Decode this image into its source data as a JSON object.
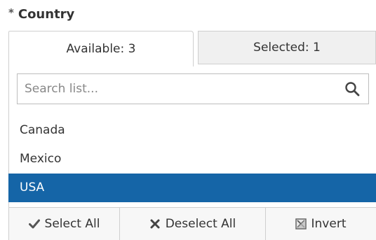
{
  "field": {
    "required_marker": "*",
    "label": "Country"
  },
  "tabs": {
    "available_label": "Available: 3",
    "selected_label": "Selected: 1"
  },
  "search": {
    "placeholder": "Search list...",
    "icon": "search-icon"
  },
  "list": {
    "items": [
      {
        "label": "Canada",
        "selected": false
      },
      {
        "label": "Mexico",
        "selected": false
      },
      {
        "label": "USA",
        "selected": true
      }
    ]
  },
  "actions": {
    "select_all": "Select All",
    "deselect_all": "Deselect All",
    "invert": "Invert"
  },
  "colors": {
    "selected_row": "#1565a7",
    "border": "#cfcfcf",
    "inactive_tab": "#f0f0f0"
  }
}
